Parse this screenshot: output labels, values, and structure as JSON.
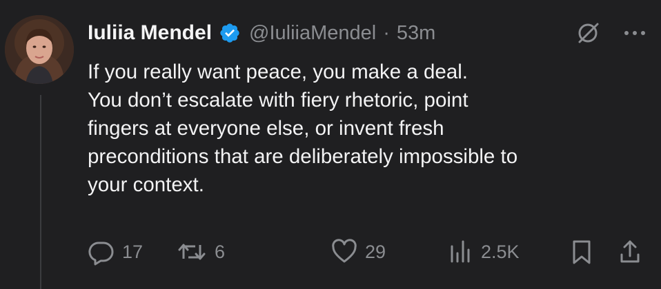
{
  "author": {
    "name": "Iuliia Mendel",
    "handle": "@IuliiaMendel",
    "separator": "·",
    "time": "53m"
  },
  "tweet": {
    "lines": [
      "If you really want peace, you make a deal.",
      "You don’t escalate with fiery rhetoric, point",
      "fingers at everyone else, or invent fresh",
      "preconditions that are deliberately impossible to",
      "your context."
    ]
  },
  "actions": {
    "replies": "17",
    "retweets": "6",
    "likes": "29",
    "views": "2.5K"
  },
  "icons": {
    "verified": "verified-badge-icon",
    "grok": "grok-slash-circle-icon",
    "more": "more-horizontal-icon",
    "reply": "reply-bubble-icon",
    "retweet": "retweet-icon",
    "like": "heart-icon",
    "views": "bar-chart-icon",
    "bookmark": "bookmark-icon",
    "share": "share-upload-icon"
  },
  "colors": {
    "background": "#1f1f21",
    "text": "#f3f3f4",
    "muted": "#8b8d91",
    "verified": "#1d9bf0"
  }
}
